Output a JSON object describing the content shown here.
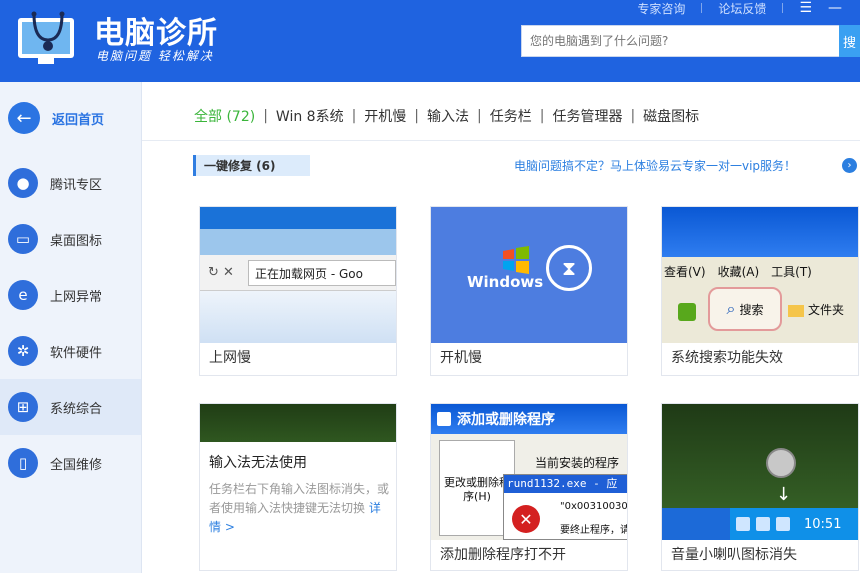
{
  "header": {
    "title": "电脑诊所",
    "subtitle": "电脑问题 轻松解决",
    "top_links": [
      "专家咨询",
      "论坛反馈"
    ],
    "search_placeholder": "您的电脑遇到了什么问题?",
    "search_button": "搜"
  },
  "sidebar": {
    "back_label": "返回首页",
    "items": [
      {
        "label": "腾讯专区",
        "icon": "penguin-icon"
      },
      {
        "label": "桌面图标",
        "icon": "monitor-icon"
      },
      {
        "label": "上网异常",
        "icon": "ie-icon"
      },
      {
        "label": "软件硬件",
        "icon": "gear-icon"
      },
      {
        "label": "系统综合",
        "icon": "windows-icon"
      },
      {
        "label": "全国维修",
        "icon": "phone-icon"
      }
    ],
    "active_index": 4
  },
  "tabs": [
    {
      "label": "全部 (72)",
      "active": true
    },
    {
      "label": "Win 8系统",
      "active": false
    },
    {
      "label": "开机慢",
      "active": false
    },
    {
      "label": "输入法",
      "active": false
    },
    {
      "label": "任务栏",
      "active": false
    },
    {
      "label": "任务管理器",
      "active": false
    },
    {
      "label": "磁盘图标",
      "active": false
    }
  ],
  "section": {
    "tag": "一键修复 (6)",
    "promo": "电脑问题搞不定？马上体验易云专家一对一vip服务！"
  },
  "cards": {
    "c1": {
      "title": "上网慢",
      "controls": "↻ ✕",
      "address": "正在加载网页 - Goo"
    },
    "c2": {
      "title": "开机慢",
      "brand": "Windows"
    },
    "c3": {
      "title": "系统搜索功能失效",
      "menu": [
        "查看(V)",
        "收藏(A)",
        "工具(T)"
      ],
      "search_btn": "搜索",
      "folder": "文件夹"
    },
    "c4": {
      "title": "输入法无法使用",
      "desc": "任务栏右下角输入法图标消失，或者使用输入法快捷键无法切换",
      "more": "详情 >"
    },
    "c5": {
      "title": "添加删除程序打不开",
      "window_title": "添加或删除程序",
      "panel_label": "更改或删除程序(H)",
      "current": "当前安装的程序",
      "dialog_title": "rund1132.exe - 应",
      "code": "\"0x00310030\"",
      "terminate": "要终止程序，请"
    },
    "c6": {
      "title": "音量小喇叭图标消失",
      "time": "10:51"
    }
  },
  "colors": {
    "header_bg": "#1f63e0",
    "accent_green": "#3bb53b",
    "link_blue": "#2c7fe0"
  }
}
